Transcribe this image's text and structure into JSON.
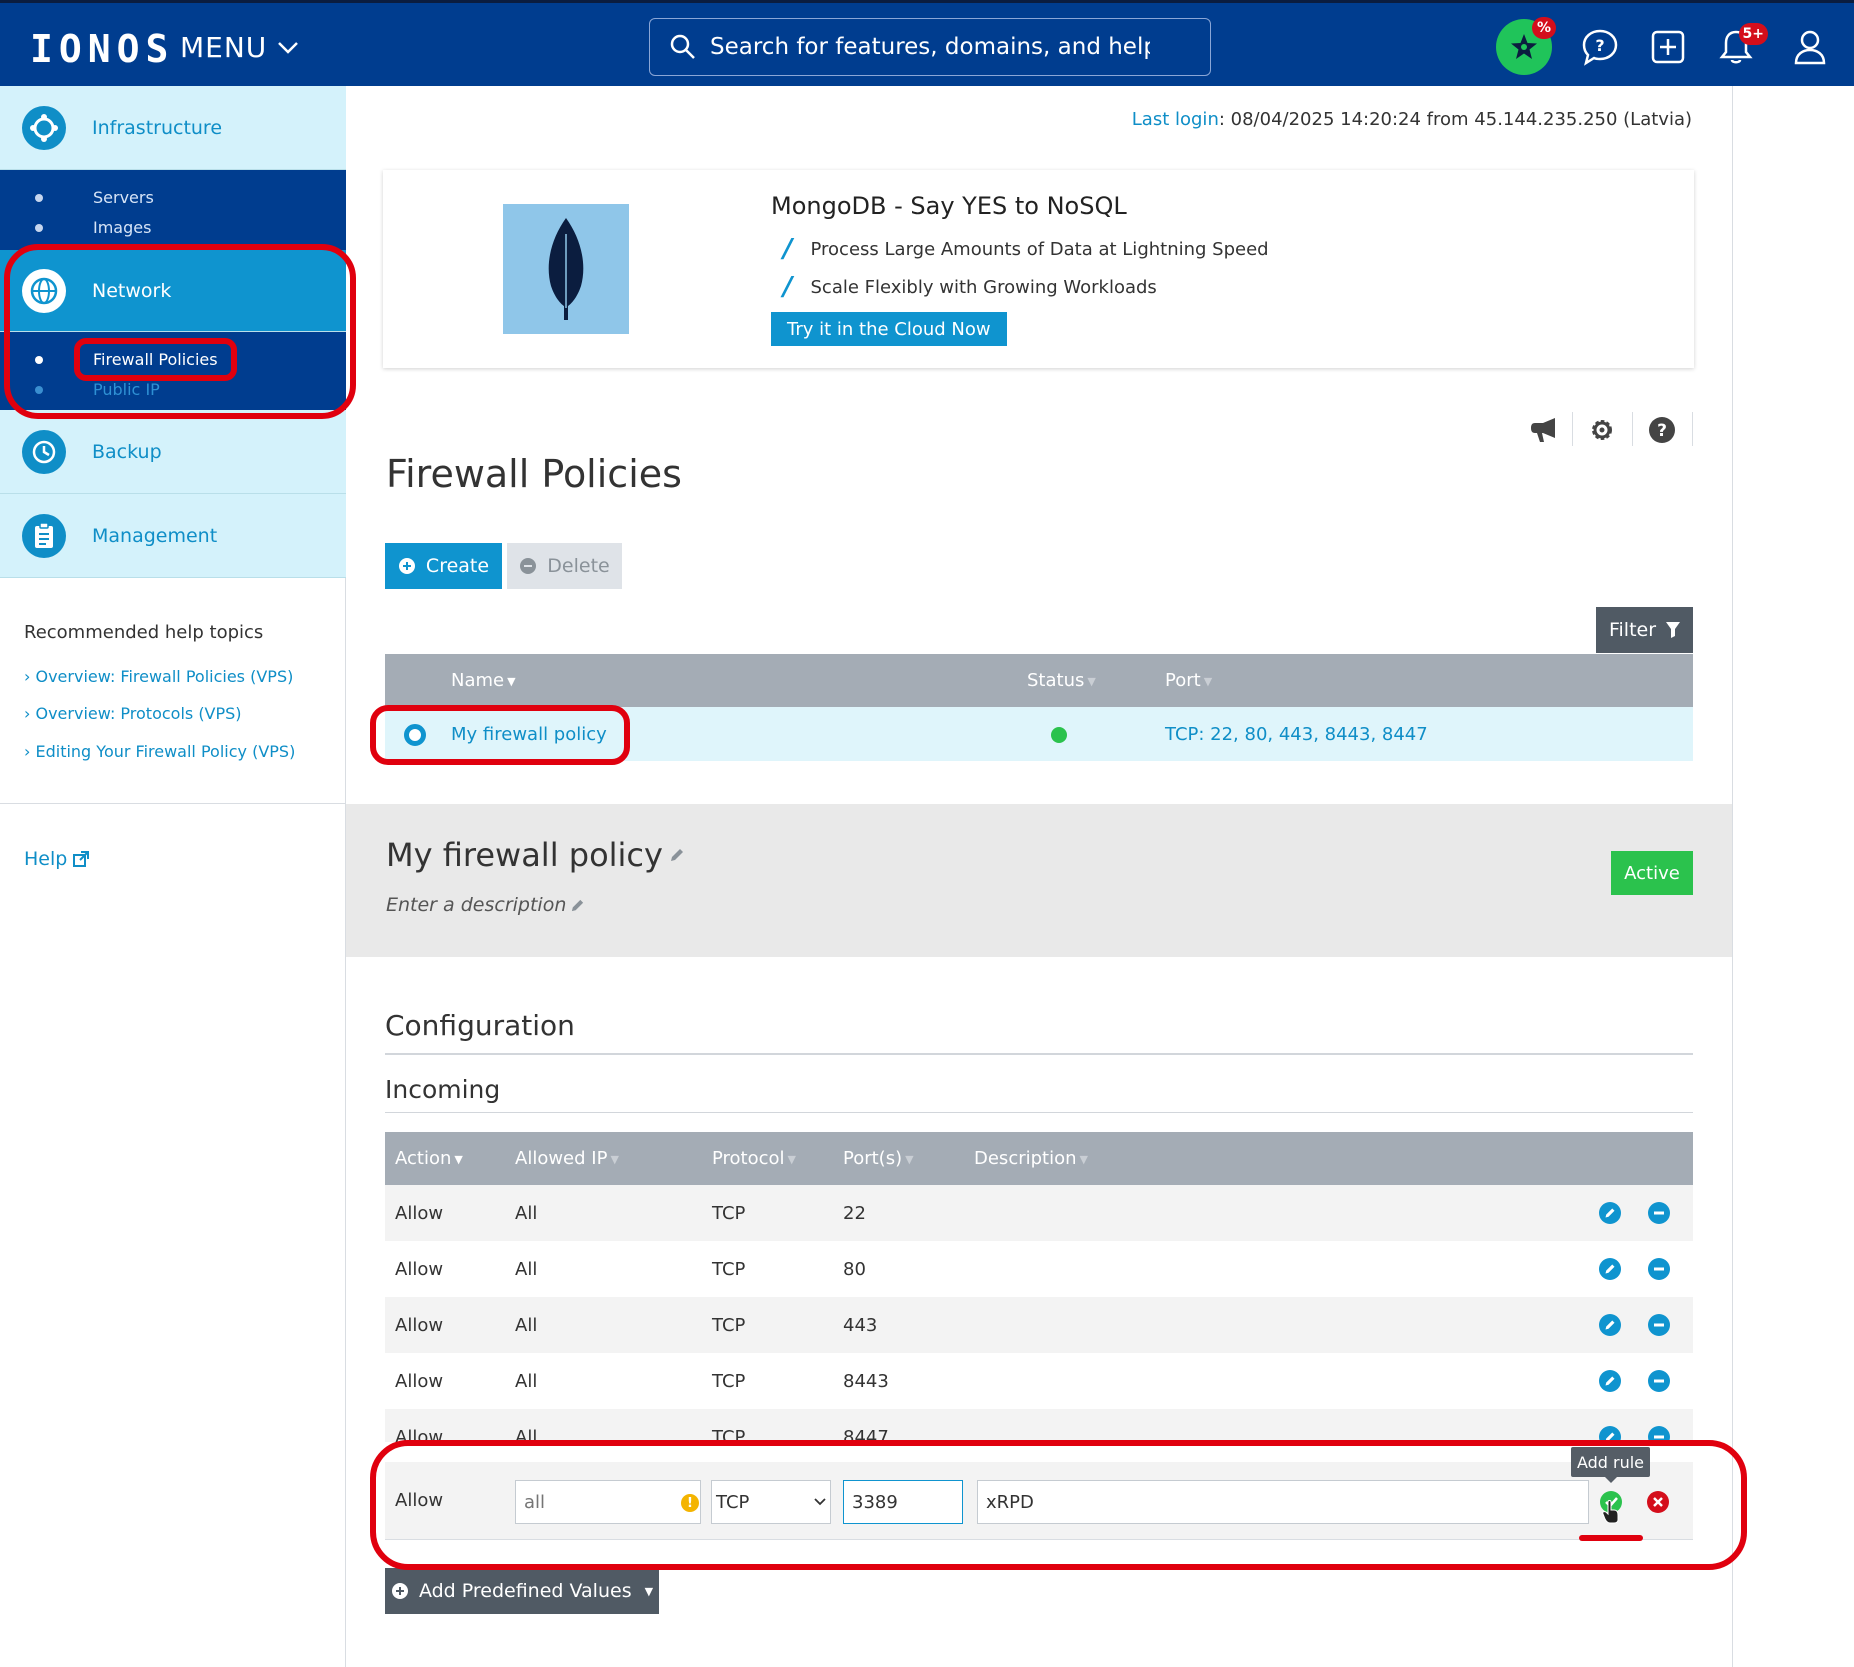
{
  "header": {
    "logo": "IONOS",
    "menu_label": "MENU",
    "search_placeholder": "Search for features, domains, and help",
    "offers_badge": "%",
    "notifications_badge": "5+"
  },
  "sidebar": {
    "categories": [
      {
        "label": "Infrastructure",
        "subitems": [
          "Servers",
          "Images"
        ]
      },
      {
        "label": "Network",
        "subitems": [
          "Firewall Policies",
          "Public IP"
        ]
      },
      {
        "label": "Backup"
      },
      {
        "label": "Management"
      }
    ],
    "help_heading": "Recommended help topics",
    "help_links": [
      "Overview: Firewall Policies (VPS)",
      "Overview: Protocols (VPS)",
      "Editing Your Firewall Policy (VPS)"
    ],
    "help_label": "Help"
  },
  "main": {
    "last_login_label": "Last login",
    "last_login_value": ": 08/04/2025 14:20:24 from 45.144.235.250 (Latvia)",
    "promo": {
      "title": "MongoDB - Say YES to NoSQL",
      "features": [
        "Process Large Amounts of Data at Lightning Speed",
        "Scale Flexibly with Growing Workloads"
      ],
      "cta": "Try it in the Cloud Now"
    },
    "page_title": "Firewall Policies",
    "create_label": "Create",
    "delete_label": "Delete",
    "filter_label": "Filter",
    "policy_table": {
      "columns": [
        "Name",
        "Status",
        "Port"
      ],
      "rows": [
        {
          "name": "My firewall policy",
          "port": "TCP: 22, 80, 443, 8443, 8447"
        }
      ]
    },
    "detail": {
      "title": "My firewall policy",
      "description_placeholder": "Enter a description",
      "status": "Active"
    },
    "configuration_heading": "Configuration",
    "incoming_heading": "Incoming",
    "rules_table": {
      "columns": [
        "Action",
        "Allowed IP",
        "Protocol",
        "Port(s)",
        "Description"
      ],
      "rows": [
        {
          "action": "Allow",
          "ip": "All",
          "protocol": "TCP",
          "port": "22"
        },
        {
          "action": "Allow",
          "ip": "All",
          "protocol": "TCP",
          "port": "80"
        },
        {
          "action": "Allow",
          "ip": "All",
          "protocol": "TCP",
          "port": "443"
        },
        {
          "action": "Allow",
          "ip": "All",
          "protocol": "TCP",
          "port": "8443"
        },
        {
          "action": "Allow",
          "ip": "All",
          "protocol": "TCP",
          "port": "8447"
        }
      ]
    },
    "new_rule": {
      "action": "Allow",
      "ip_placeholder": "all",
      "protocol": "TCP",
      "port_value": "3389",
      "description_value": "xRPD",
      "tooltip": "Add rule"
    },
    "add_predefined_label": "Add Predefined Values"
  },
  "colors": {
    "header_bg": "#003d8f",
    "accent": "#0f94cf",
    "status_green": "#2bc24d",
    "annotation_red": "#e0000e"
  }
}
